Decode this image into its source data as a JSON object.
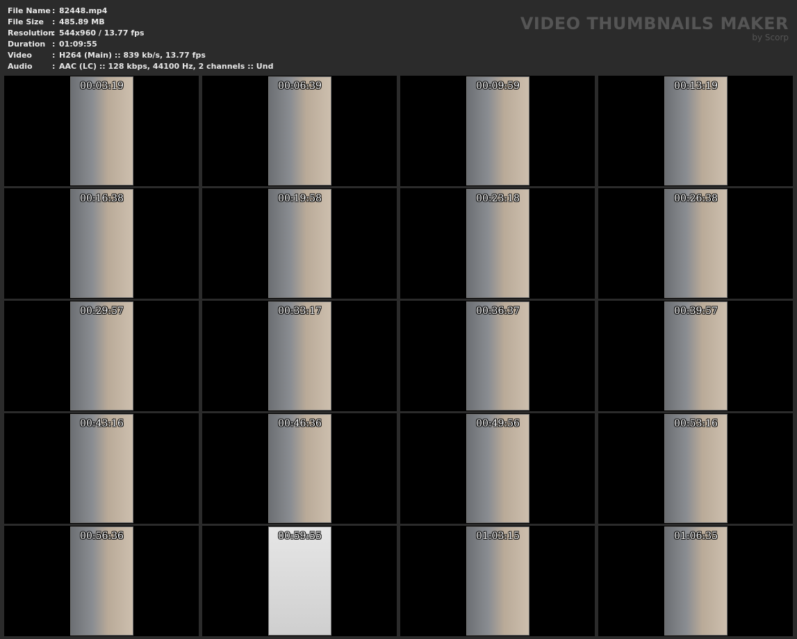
{
  "info": [
    {
      "label": "File Name",
      "value": "82448.mp4"
    },
    {
      "label": "File Size",
      "value": "485.89 MB"
    },
    {
      "label": "Resolution",
      "value": "544x960 / 13.77 fps"
    },
    {
      "label": "Duration",
      "value": "01:09:55"
    },
    {
      "label": "Video",
      "value": "H264 (Main) :: 839 kb/s, 13.77 fps"
    },
    {
      "label": "Audio",
      "value": "AAC (LC) :: 128 kbps, 44100 Hz, 2 channels :: Und"
    }
  ],
  "logo": {
    "title": "VIDEO THUMBNAILS MAKER",
    "subtitle": "by Scorp"
  },
  "thumbnails": [
    "00:03:19",
    "00:06:39",
    "00:09:59",
    "00:13:19",
    "00:16:38",
    "00:19:58",
    "00:23:18",
    "00:26:38",
    "00:29:57",
    "00:33:17",
    "00:36:37",
    "00:39:57",
    "00:43:16",
    "00:46:36",
    "00:49:56",
    "00:53:16",
    "00:56:36",
    "00:59:55",
    "01:03:15",
    "01:06:35"
  ]
}
